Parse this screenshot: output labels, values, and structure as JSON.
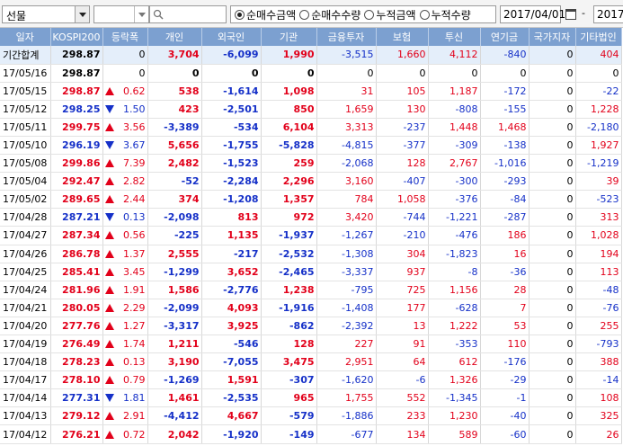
{
  "toolbar": {
    "combo_value": "선물",
    "radios": [
      {
        "label": "순매수금액",
        "selected": true
      },
      {
        "label": "순매수수량",
        "selected": false
      },
      {
        "label": "누적금액",
        "selected": false
      },
      {
        "label": "누적수량",
        "selected": false
      }
    ],
    "date_from": "2017/04/01",
    "date_sep": "-",
    "date_to": "2017/"
  },
  "table": {
    "headers": [
      "일자",
      "KOSPI200",
      "등락폭",
      "개인",
      "외국인",
      "기관",
      "금융투자",
      "보험",
      "투신",
      "연기금",
      "국가지자",
      "기타법인"
    ],
    "total_row": {
      "label": "기간합계",
      "kospi": "298.87",
      "chg": "0",
      "values": [
        "3,704",
        "-6,099",
        "1,990",
        "-3,515",
        "1,660",
        "4,112",
        "-840",
        "0",
        "404"
      ]
    },
    "rows": [
      {
        "date": "17/05/16",
        "kospi": "298.87",
        "dir": "flat",
        "chg": "0",
        "values": [
          "0",
          "0",
          "0",
          "0",
          "0",
          "0",
          "0",
          "0",
          "0"
        ]
      },
      {
        "date": "17/05/15",
        "kospi": "298.87",
        "dir": "up",
        "chg": "0.62",
        "values": [
          "538",
          "-1,614",
          "1,098",
          "31",
          "105",
          "1,187",
          "-172",
          "0",
          "-22"
        ]
      },
      {
        "date": "17/05/12",
        "kospi": "298.25",
        "dir": "dn",
        "chg": "1.50",
        "values": [
          "423",
          "-2,501",
          "850",
          "1,659",
          "130",
          "-808",
          "-155",
          "0",
          "1,228"
        ]
      },
      {
        "date": "17/05/11",
        "kospi": "299.75",
        "dir": "up",
        "chg": "3.56",
        "values": [
          "-3,389",
          "-534",
          "6,104",
          "3,313",
          "-237",
          "1,448",
          "1,468",
          "0",
          "-2,180"
        ]
      },
      {
        "date": "17/05/10",
        "kospi": "296.19",
        "dir": "dn",
        "chg": "3.67",
        "values": [
          "5,656",
          "-1,755",
          "-5,828",
          "-4,815",
          "-377",
          "-309",
          "-138",
          "0",
          "1,927"
        ]
      },
      {
        "date": "17/05/08",
        "kospi": "299.86",
        "dir": "up",
        "chg": "7.39",
        "values": [
          "2,482",
          "-1,523",
          "259",
          "-2,068",
          "128",
          "2,767",
          "-1,016",
          "0",
          "-1,219"
        ]
      },
      {
        "date": "17/05/04",
        "kospi": "292.47",
        "dir": "up",
        "chg": "2.82",
        "values": [
          "-52",
          "-2,284",
          "2,296",
          "3,160",
          "-407",
          "-300",
          "-293",
          "0",
          "39"
        ]
      },
      {
        "date": "17/05/02",
        "kospi": "289.65",
        "dir": "up",
        "chg": "2.44",
        "values": [
          "374",
          "-1,208",
          "1,357",
          "784",
          "1,058",
          "-376",
          "-84",
          "0",
          "-523"
        ]
      },
      {
        "date": "17/04/28",
        "kospi": "287.21",
        "dir": "dn",
        "chg": "0.13",
        "values": [
          "-2,098",
          "813",
          "972",
          "3,420",
          "-744",
          "-1,221",
          "-287",
          "0",
          "313"
        ]
      },
      {
        "date": "17/04/27",
        "kospi": "287.34",
        "dir": "up",
        "chg": "0.56",
        "values": [
          "-225",
          "1,135",
          "-1,937",
          "-1,267",
          "-210",
          "-476",
          "186",
          "0",
          "1,028"
        ]
      },
      {
        "date": "17/04/26",
        "kospi": "286.78",
        "dir": "up",
        "chg": "1.37",
        "values": [
          "2,555",
          "-217",
          "-2,532",
          "-1,308",
          "304",
          "-1,823",
          "16",
          "0",
          "194"
        ]
      },
      {
        "date": "17/04/25",
        "kospi": "285.41",
        "dir": "up",
        "chg": "3.45",
        "values": [
          "-1,299",
          "3,652",
          "-2,465",
          "-3,337",
          "937",
          "-8",
          "-36",
          "0",
          "113"
        ]
      },
      {
        "date": "17/04/24",
        "kospi": "281.96",
        "dir": "up",
        "chg": "1.91",
        "values": [
          "1,586",
          "-2,776",
          "1,238",
          "-795",
          "725",
          "1,156",
          "28",
          "0",
          "-48"
        ]
      },
      {
        "date": "17/04/21",
        "kospi": "280.05",
        "dir": "up",
        "chg": "2.29",
        "values": [
          "-2,099",
          "4,093",
          "-1,916",
          "-1,408",
          "177",
          "-628",
          "7",
          "0",
          "-76"
        ]
      },
      {
        "date": "17/04/20",
        "kospi": "277.76",
        "dir": "up",
        "chg": "1.27",
        "values": [
          "-3,317",
          "3,925",
          "-862",
          "-2,392",
          "13",
          "1,222",
          "53",
          "0",
          "255"
        ]
      },
      {
        "date": "17/04/19",
        "kospi": "276.49",
        "dir": "up",
        "chg": "1.74",
        "values": [
          "1,211",
          "-546",
          "128",
          "227",
          "91",
          "-353",
          "110",
          "0",
          "-793"
        ]
      },
      {
        "date": "17/04/18",
        "kospi": "278.23",
        "dir": "up",
        "chg": "0.13",
        "values": [
          "3,190",
          "-7,055",
          "3,475",
          "2,951",
          "64",
          "612",
          "-176",
          "0",
          "388"
        ]
      },
      {
        "date": "17/04/17",
        "kospi": "278.10",
        "dir": "up",
        "chg": "0.79",
        "values": [
          "-1,269",
          "1,591",
          "-307",
          "-1,620",
          "-6",
          "1,326",
          "-29",
          "0",
          "-14"
        ]
      },
      {
        "date": "17/04/14",
        "kospi": "277.31",
        "dir": "dn",
        "chg": "1.81",
        "values": [
          "1,461",
          "-2,535",
          "965",
          "1,755",
          "552",
          "-1,345",
          "-1",
          "0",
          "108"
        ]
      },
      {
        "date": "17/04/13",
        "kospi": "279.12",
        "dir": "up",
        "chg": "2.91",
        "values": [
          "-4,412",
          "4,667",
          "-579",
          "-1,886",
          "233",
          "1,230",
          "-40",
          "0",
          "325"
        ]
      },
      {
        "date": "17/04/12",
        "kospi": "276.21",
        "dir": "up",
        "chg": "0.72",
        "values": [
          "2,042",
          "-1,920",
          "-149",
          "-677",
          "134",
          "589",
          "-60",
          "0",
          "26"
        ]
      }
    ]
  },
  "colors": {
    "up": "#e2001a",
    "down": "#1530c8",
    "header_bg": "#7ca0d0",
    "total_bg": "#e4eefa"
  },
  "icons": {
    "dropdown": "chevron-down-icon",
    "search": "search-icon",
    "calendar": "calendar-icon",
    "up": "triangle-up-icon",
    "down": "triangle-down-icon"
  }
}
